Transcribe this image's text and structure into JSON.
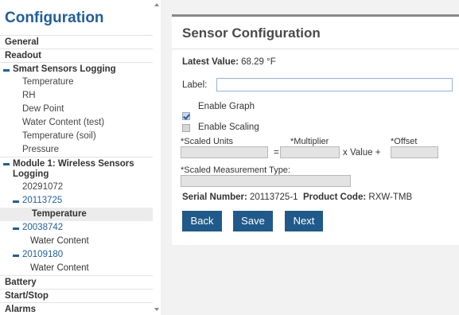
{
  "sidebar": {
    "title": "Configuration",
    "items": {
      "general": "General",
      "readout": "Readout",
      "smart_sensors": "Smart Sensors Logging",
      "temperature": "Temperature",
      "rh": "RH",
      "dew_point": "Dew Point",
      "water_content_test": "Water Content (test)",
      "temperature_soil": "Temperature (soil)",
      "pressure": "Pressure",
      "module1": "Module 1: Wireless Sensors Logging",
      "sn1": "20291072",
      "sn2": "20113725",
      "sn2_temperature": "Temperature",
      "sn3": "20038742",
      "sn3_water": "Water Content",
      "sn4": "20109180",
      "sn4_water": "Water Content",
      "battery": "Battery",
      "start_stop": "Start/Stop",
      "alarms": "Alarms"
    }
  },
  "panel": {
    "title": "Sensor Configuration",
    "latest_label": "Latest Value:",
    "latest_value": "68.29 °F",
    "label_field_label": "Label:",
    "label_value": "",
    "enable_graph": "Enable Graph",
    "enable_graph_checked": true,
    "enable_scaling": "Enable Scaling",
    "enable_scaling_checked": false,
    "scaled_units_label": "*Scaled Units",
    "multiplier_label": "*Multiplier",
    "offset_label": "*Offset",
    "equals": "=",
    "x_value_plus": "x Value +",
    "scaled_type_label": "*Scaled Measurement Type:",
    "serial_label": "Serial Number:",
    "serial_value": "20113725-1",
    "product_label": "Product Code:",
    "product_value": "RXW-TMB"
  },
  "buttons": {
    "back": "Back",
    "save": "Save",
    "next": "Next"
  },
  "colors": {
    "accent": "#1f5f9b",
    "button": "#1f5a8a"
  }
}
